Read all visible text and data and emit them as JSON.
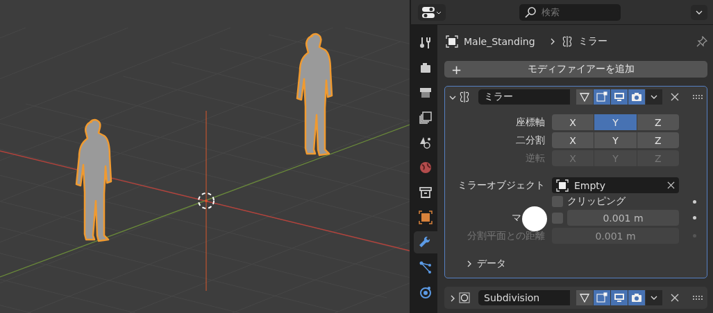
{
  "header": {
    "search": {
      "placeholder": "検索"
    }
  },
  "tabs": [
    {
      "kind": "tool",
      "selected": false
    },
    {
      "kind": "render",
      "selected": false
    },
    {
      "kind": "output",
      "selected": false
    },
    {
      "kind": "view_layer",
      "selected": false
    },
    {
      "kind": "scene",
      "selected": false
    },
    {
      "kind": "world",
      "selected": false
    },
    {
      "kind": "collection",
      "selected": false
    },
    {
      "kind": "object",
      "selected": false
    },
    {
      "kind": "modifiers",
      "selected": true
    },
    {
      "kind": "particles",
      "selected": false
    },
    {
      "kind": "physics",
      "selected": false
    }
  ],
  "breadcrumb": {
    "object": "Male_Standing",
    "modifier": "ミラー"
  },
  "add_modifier_button": {
    "icon": "+",
    "label": "モディファイアーを追加"
  },
  "modifiers": [
    {
      "kind": "mirror",
      "name": "ミラー",
      "expanded": true,
      "toggles": [
        {
          "kind": "cage",
          "on": false
        },
        {
          "kind": "edit_mode",
          "on": true
        },
        {
          "kind": "viewport",
          "on": true
        },
        {
          "kind": "render",
          "on": true
        }
      ],
      "axis_rows": [
        {
          "label": "座標軸",
          "disabled": false,
          "buttons": [
            {
              "label": "X",
              "selected": false
            },
            {
              "label": "Y",
              "selected": true
            },
            {
              "label": "Z",
              "selected": false
            }
          ]
        },
        {
          "label": "二分割",
          "disabled": false,
          "buttons": [
            {
              "label": "X",
              "selected": false
            },
            {
              "label": "Y",
              "selected": false
            },
            {
              "label": "Z",
              "selected": false
            }
          ]
        },
        {
          "label": "逆転",
          "disabled": true,
          "buttons": [
            {
              "label": "X",
              "selected": false
            },
            {
              "label": "Y",
              "selected": false
            },
            {
              "label": "Z",
              "selected": false
            }
          ]
        }
      ],
      "mirror_object": {
        "label": "ミラーオブジェクト",
        "value": "Empty"
      },
      "clipping": {
        "label": "クリッピング",
        "checked": false
      },
      "merge": {
        "label": "マ",
        "checked": false,
        "value": "0.001 m"
      },
      "bisect_distance": {
        "label": "分割平面との距離",
        "value": "0.001 m",
        "disabled": true
      },
      "data_section": {
        "label": "データ",
        "expanded": false
      }
    },
    {
      "kind": "subdivision",
      "name": "Subdivision",
      "expanded": false,
      "toggles": [
        {
          "kind": "cage",
          "on": false
        },
        {
          "kind": "edit_mode",
          "on": true
        },
        {
          "kind": "viewport",
          "on": true
        },
        {
          "kind": "render",
          "on": true
        }
      ]
    }
  ]
}
